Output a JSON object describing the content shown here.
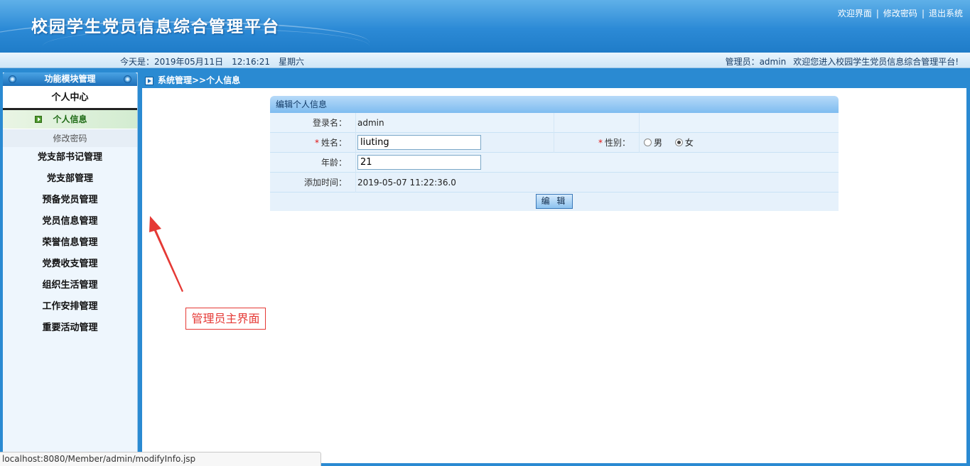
{
  "header": {
    "title": "校园学生党员信息综合管理平台",
    "links": [
      "欢迎界面",
      "修改密码",
      "退出系统"
    ],
    "separator": "|"
  },
  "status": {
    "date_label": "今天是：2019年05月11日",
    "time": "12:16:21",
    "weekday": "星期六",
    "admin_label": "管理员：admin",
    "welcome_text": "欢迎您进入校园学生党员信息综合管理平台!"
  },
  "sidebar": {
    "title": "功能模块管理",
    "section": "个人中心",
    "subitems": [
      {
        "label": "个人信息",
        "active": true
      },
      {
        "label": "修改密码",
        "active": false
      }
    ],
    "items": [
      "党支部书记管理",
      "党支部管理",
      "预备党员管理",
      "党员信息管理",
      "荣誉信息管理",
      "党费收支管理",
      "组织生活管理",
      "工作安排管理",
      "重要活动管理"
    ]
  },
  "breadcrumb": "系统管理>>个人信息",
  "form": {
    "title": "编辑个人信息",
    "login_label": "登录名：",
    "login_value": "admin",
    "name_label": "姓名：",
    "name_value": "liuting",
    "gender_label": "性别：",
    "gender_options": [
      "男",
      "女"
    ],
    "gender_selected": "女",
    "age_label": "年龄：",
    "age_value": "21",
    "added_label": "添加时间：",
    "added_value": "2019-05-07 11:22:36.0",
    "required_mark": "*",
    "submit_label": "编 辑"
  },
  "annotation": {
    "text": "管理员主界面",
    "color": "#e53935"
  },
  "browser_status": {
    "url": "localhost:8080/Member/admin/modifyInfo.jsp"
  },
  "colors": {
    "frame_blue": "#2a8ad2",
    "header_blue": "#2c8ad6",
    "active_green": "#1d6a14"
  }
}
